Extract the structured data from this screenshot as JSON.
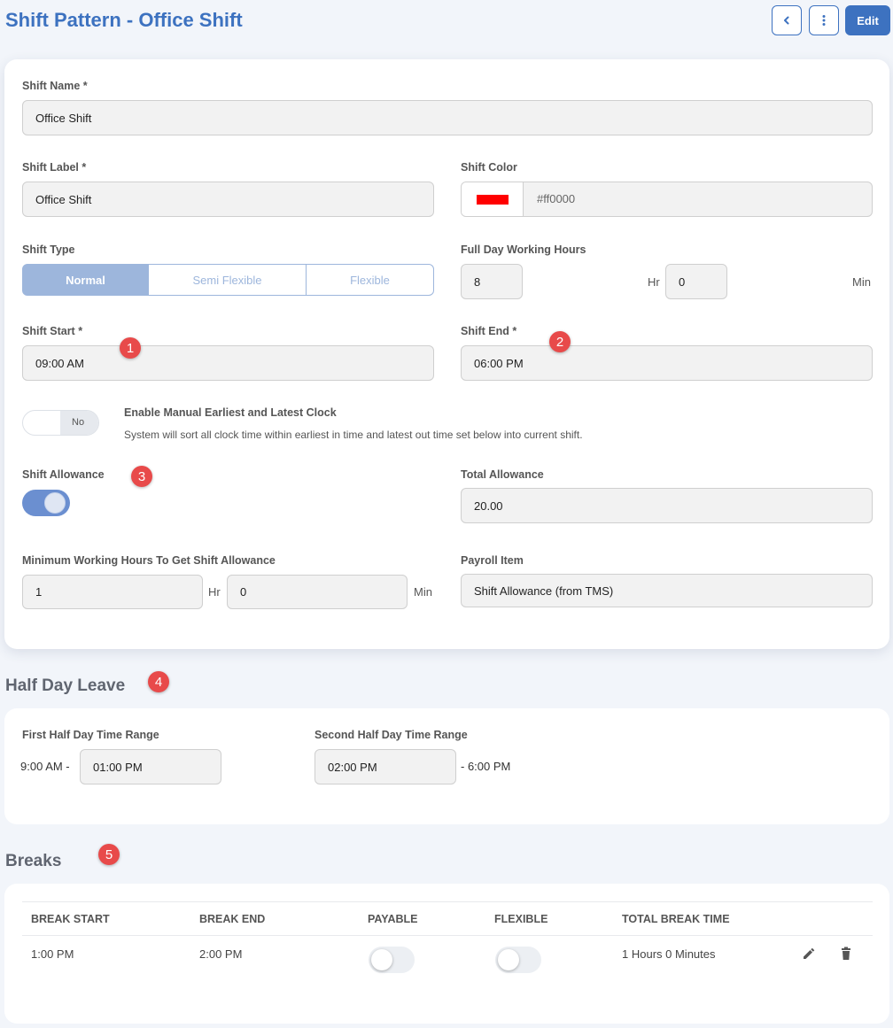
{
  "header": {
    "title": "Shift Pattern - Office Shift",
    "back_icon": "chevron-left-icon",
    "more_icon": "kebab-menu-icon",
    "edit_label": "Edit"
  },
  "shift": {
    "name_label": "Shift Name *",
    "name_value": "Office Shift",
    "label_label": "Shift Label *",
    "label_value": "Office Shift",
    "color_label": "Shift Color",
    "color_value": "#ff0000",
    "type_label": "Shift Type",
    "type_options": [
      "Normal",
      "Semi Flexible",
      "Flexible"
    ],
    "type_selected": "Normal",
    "full_day_label": "Full Day Working Hours",
    "full_day_hours": "8",
    "full_day_minutes": "0",
    "hr_unit": "Hr",
    "min_unit": "Min",
    "start_label": "Shift Start *",
    "start_value": "09:00 AM",
    "end_label": "Shift End *",
    "end_value": "06:00 PM",
    "manual_clock_toggle": "No",
    "manual_clock_title": "Enable Manual Earliest and Latest Clock",
    "manual_clock_desc": "System will sort all clock time within earliest in time and latest out time set below into current shift.",
    "allowance_label": "Shift Allowance",
    "allowance_enabled": true,
    "total_allowance_label": "Total Allowance",
    "total_allowance_value": "20.00",
    "min_hours_label": "Minimum Working Hours To Get Shift Allowance",
    "min_hours_value": "1",
    "min_minutes_value": "0",
    "payroll_item_label": "Payroll Item",
    "payroll_item_value": "Shift Allowance (from TMS)"
  },
  "half_day": {
    "title": "Half Day Leave",
    "first_label": "First Half Day Time Range",
    "first_start": "9:00 AM -",
    "first_end": "01:00 PM",
    "second_label": "Second Half Day Time Range",
    "second_start": "02:00 PM",
    "second_end": "- 6:00 PM"
  },
  "breaks": {
    "title": "Breaks",
    "columns": [
      "BREAK START",
      "BREAK END",
      "PAYABLE",
      "FLEXIBLE",
      "TOTAL BREAK TIME"
    ],
    "rows": [
      {
        "start": "1:00 PM",
        "end": "2:00 PM",
        "payable": false,
        "flexible": false,
        "total": "1 Hours 0 Minutes"
      }
    ]
  },
  "markers": [
    "1",
    "2",
    "3",
    "4",
    "5"
  ],
  "colors": {
    "accent": "#3d72c0",
    "segment_active": "#9db6dc",
    "marker": "#e84a4a",
    "toggle_on": "#6b8fd0"
  }
}
